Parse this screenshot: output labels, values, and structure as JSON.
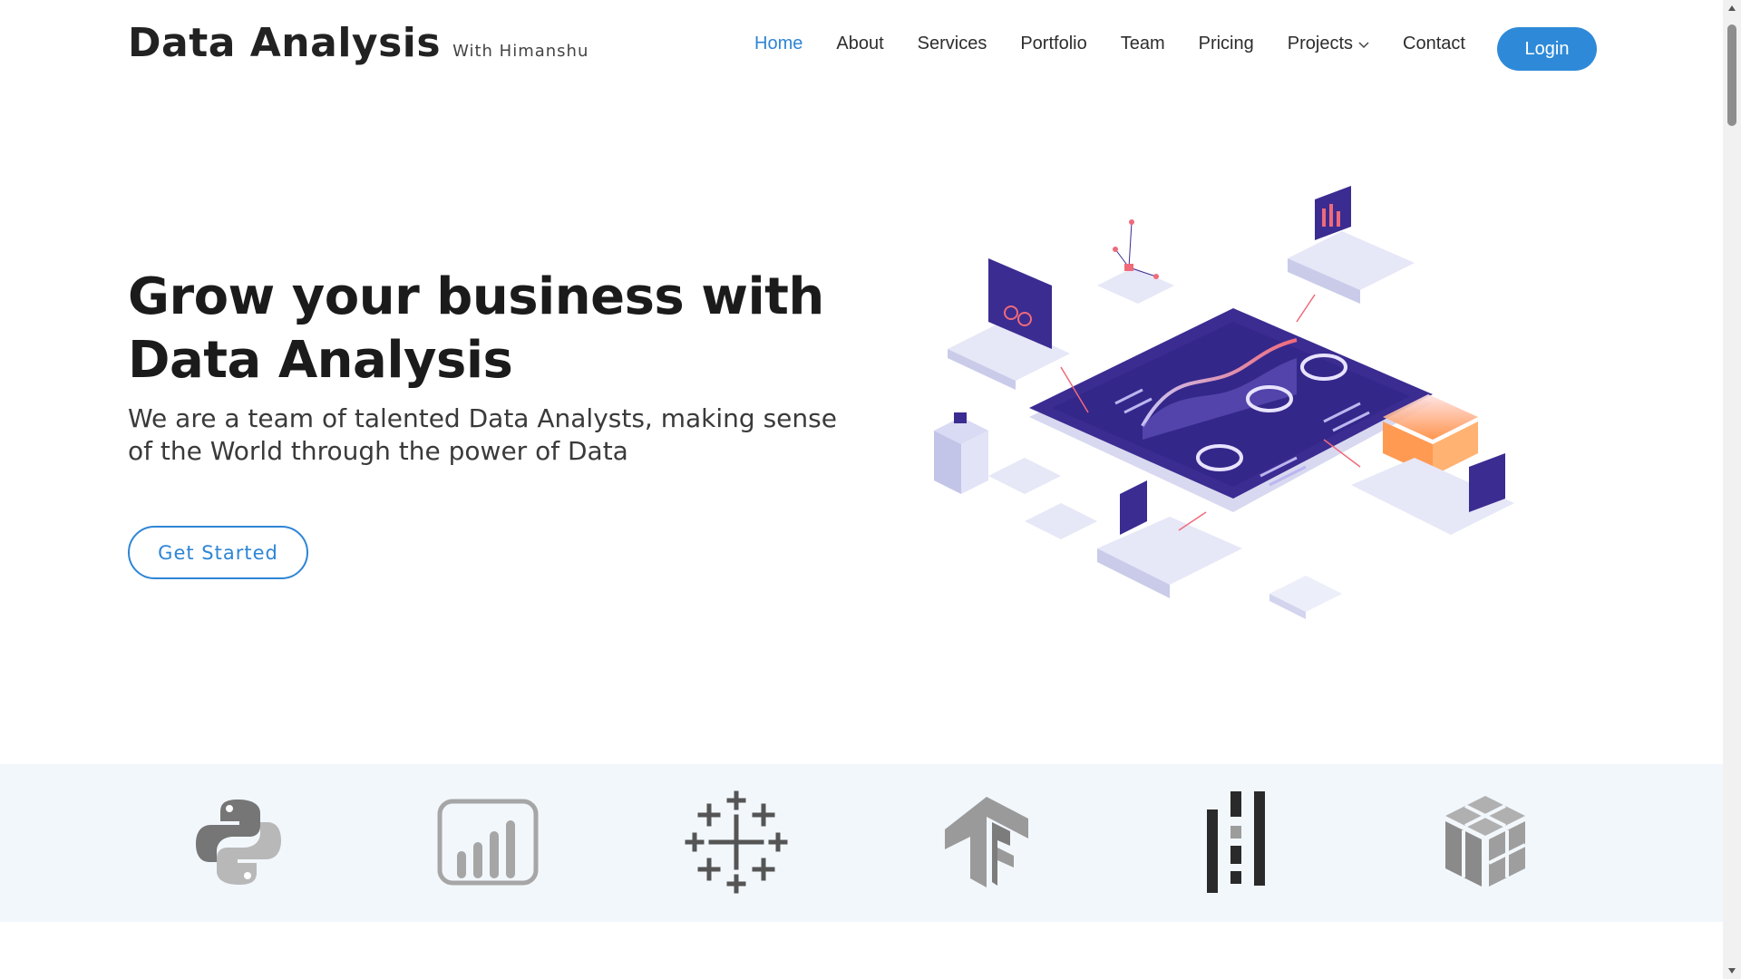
{
  "brand": {
    "title": "Data Analysis",
    "subtitle": "With Himanshu"
  },
  "nav": {
    "items": [
      {
        "label": "Home",
        "active": true
      },
      {
        "label": "About"
      },
      {
        "label": "Services"
      },
      {
        "label": "Portfolio"
      },
      {
        "label": "Team"
      },
      {
        "label": "Pricing"
      },
      {
        "label": "Projects",
        "dropdown": true
      },
      {
        "label": "Contact"
      }
    ],
    "login_label": "Login"
  },
  "hero": {
    "title": "Grow your business with Data Analysis",
    "subtitle": "We are a team of talented Data Analysts, making sense of the World through the power of Data",
    "cta_label": "Get Started",
    "illustration_icon": "isometric-data-dashboard-illustration"
  },
  "clients": {
    "icons": [
      "python-logo-icon",
      "power-bi-logo-icon",
      "tableau-logo-icon",
      "tensorflow-logo-icon",
      "pandas-logo-icon",
      "numpy-logo-icon"
    ]
  },
  "colors": {
    "accent": "#2e85d6",
    "login_bg": "#2e8ad8",
    "strip_bg": "#f2f7fc",
    "logo_gray": "#9a9a9a",
    "dark": "#1b1b1b"
  }
}
